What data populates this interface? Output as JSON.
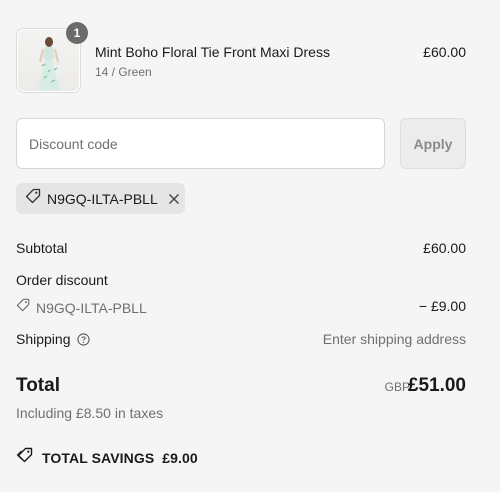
{
  "product": {
    "quantity": "1",
    "name": "Mint Boho Floral Tie Front Maxi Dress",
    "variant": "14 / Green",
    "price": "£60.00",
    "image_icon": "dress-photo"
  },
  "discount": {
    "placeholder": "Discount code",
    "value": "",
    "apply_label": "Apply",
    "applied_code": "N9GQ-ILTA-PBLL"
  },
  "summary": {
    "subtotal_label": "Subtotal",
    "subtotal_value": "£60.00",
    "order_discount_label": "Order discount",
    "discount_code": "N9GQ-ILTA-PBLL",
    "discount_value": "− £9.00",
    "shipping_label": "Shipping",
    "shipping_value": "Enter shipping address"
  },
  "total": {
    "label": "Total",
    "currency": "GBP",
    "value": "£51.00",
    "taxes_note": "Including £8.50 in taxes"
  },
  "savings": {
    "label": "TOTAL SAVINGS",
    "value": "£9.00"
  },
  "colors": {
    "background": "#f5f5f5",
    "text": "#1a1a1a",
    "muted": "#707070",
    "badge": "#6b6b6b"
  }
}
